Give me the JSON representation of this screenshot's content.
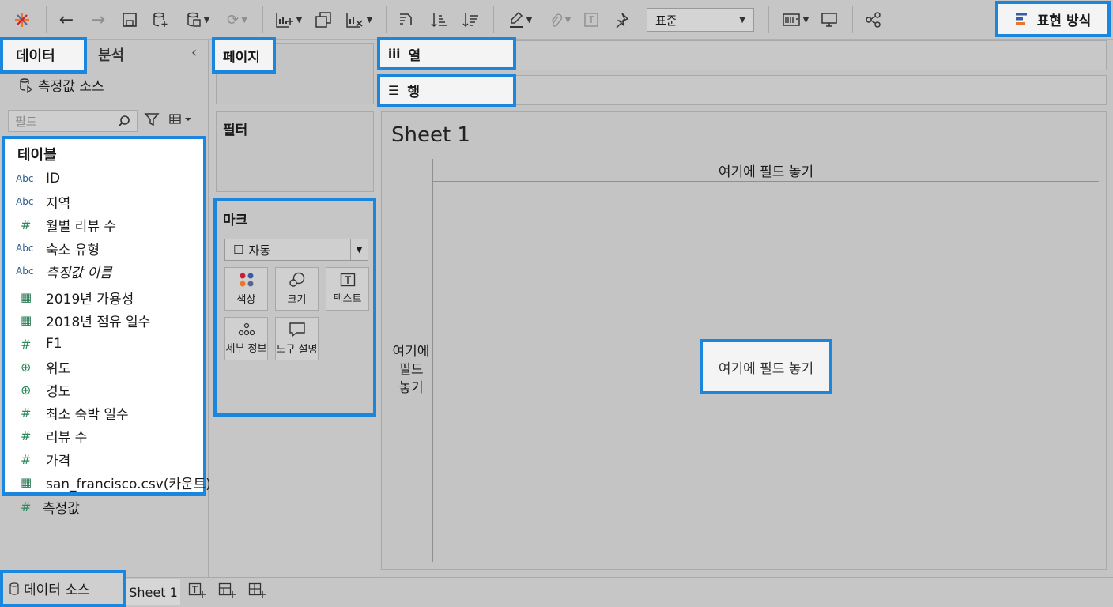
{
  "toolbar": {
    "format_select": "표준",
    "show_me_label": "표현 방식"
  },
  "data_pane": {
    "tab_data": "데이터",
    "tab_analysis": "분석",
    "collapse": "‹",
    "data_source_name": "측정값 소스",
    "search_placeholder": "필드",
    "tables_header": "테이블",
    "fields": [
      {
        "type": "Abc",
        "name": "ID"
      },
      {
        "type": "Abc",
        "name": "지역"
      },
      {
        "type": "#",
        "name": "월별 리뷰 수"
      },
      {
        "type": "Abc",
        "name": "숙소 유형"
      },
      {
        "type": "Abc",
        "name": "측정값 이름"
      },
      {
        "type": "table",
        "name": "2019년 가용성"
      },
      {
        "type": "table",
        "name": "2018년 점유 일수"
      },
      {
        "type": "#",
        "name": "F1"
      },
      {
        "type": "geo",
        "name": "위도"
      },
      {
        "type": "geo",
        "name": "경도"
      },
      {
        "type": "#",
        "name": "최소 숙박 일수"
      },
      {
        "type": "#",
        "name": "리뷰 수"
      },
      {
        "type": "#",
        "name": "가격"
      },
      {
        "type": "table",
        "name": "san_francisco.csv(카운트)"
      }
    ],
    "measure_values": {
      "type": "#",
      "name": "측정값"
    }
  },
  "cards": {
    "pages": "페이지",
    "filters": "필터",
    "marks": "마크",
    "mark_type": "자동",
    "mark_buttons": [
      "색상",
      "크기",
      "텍스트",
      "세부 정보",
      "도구 설명"
    ]
  },
  "shelves": {
    "columns": "열",
    "rows": "행"
  },
  "view": {
    "sheet_title": "Sheet 1",
    "columns_drop": "여기에 필드 놓기",
    "rows_drop_1": "여기에",
    "rows_drop_2": "필드",
    "rows_drop_3": "놓기",
    "center_drop": "여기에 필드 놓기"
  },
  "bottom": {
    "data_source_tab": "데이터 소스",
    "sheet_tab": "Sheet 1"
  },
  "colors": {
    "highlight": "#1a86dd",
    "background": "#c4c4c4",
    "panel_white": "#ffffff"
  }
}
